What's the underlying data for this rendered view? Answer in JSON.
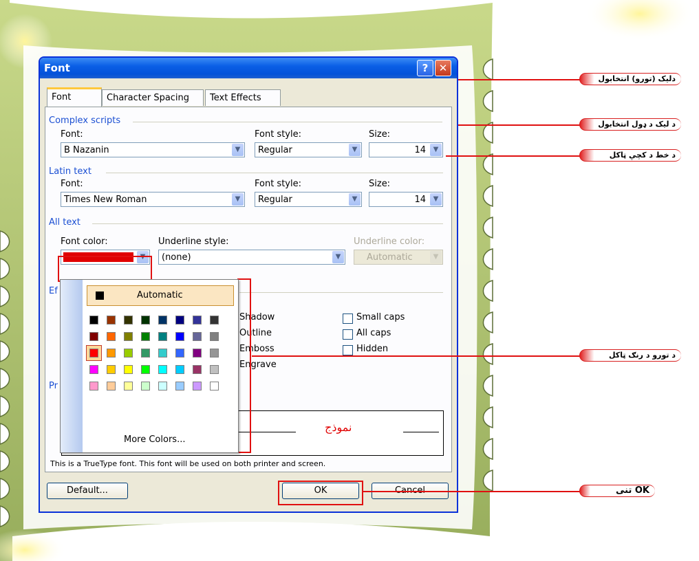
{
  "dialog": {
    "title": "Font",
    "help_button": "?",
    "close_button": "✕",
    "tabs": [
      "Font",
      "Character Spacing",
      "Text Effects"
    ],
    "complex_scripts": {
      "group_label": "Complex scripts",
      "font_label": "Font:",
      "font_value": "B Nazanin",
      "style_label": "Font style:",
      "style_value": "Regular",
      "size_label": "Size:",
      "size_value": "14"
    },
    "latin_text": {
      "group_label": "Latin text",
      "font_label": "Font:",
      "font_value": "Times New Roman",
      "style_label": "Font style:",
      "style_value": "Regular",
      "size_label": "Size:",
      "size_value": "14"
    },
    "all_text": {
      "group_label": "All text",
      "font_color_label": "Font color:",
      "font_color_value": "#e00000",
      "underline_style_label": "Underline style:",
      "underline_style_value": "(none)",
      "underline_color_label": "Underline color:",
      "underline_color_value": "Automatic"
    },
    "effects": {
      "group_label_partial": "Ef",
      "shadow": "Shadow",
      "outline": "Outline",
      "emboss": "Emboss",
      "engrave": "Engrave",
      "small_caps": "Small caps",
      "all_caps": "All caps",
      "hidden": "Hidden"
    },
    "preview": {
      "group_label_partial": "Pr",
      "sample_text": "نموذج"
    },
    "truetype_note": "This is a TrueType font. This font will be used on both printer and screen.",
    "buttons": {
      "default": "Default...",
      "ok": "OK",
      "cancel": "Cancel"
    }
  },
  "color_popup": {
    "automatic": "Automatic",
    "more_colors": "More Colors...",
    "swatches": [
      [
        "#000000",
        "#993300",
        "#333300",
        "#003300",
        "#003366",
        "#000080",
        "#333399",
        "#333333"
      ],
      [
        "#800000",
        "#ff6600",
        "#808000",
        "#008000",
        "#008080",
        "#0000ff",
        "#666699",
        "#808080"
      ],
      [
        "#ff0000",
        "#ff9900",
        "#99cc00",
        "#339966",
        "#33cccc",
        "#3366ff",
        "#800080",
        "#969696"
      ],
      [
        "#ff00ff",
        "#ffcc00",
        "#ffff00",
        "#00ff00",
        "#00ffff",
        "#00ccff",
        "#993366",
        "#c0c0c0"
      ],
      [
        "#ff99cc",
        "#ffcc99",
        "#ffff99",
        "#ccffcc",
        "#ccffff",
        "#99ccff",
        "#cc99ff",
        "#ffffff"
      ]
    ],
    "selected_swatch": "#ff0000"
  },
  "callouts": {
    "select_font_type": "دليک (تورو) انتخابول",
    "select_font_kind": "د ليک د ډول انتخابول",
    "set_font_size": "د خط د کچې ټاکل",
    "set_font_color": "د تورو د رنګ ټاکل",
    "press_ok": "OK تنی"
  },
  "colors": {
    "annotation_red": "#e01010",
    "frame_green": "#a8be6a",
    "title_blue": "#0a5fe6"
  }
}
